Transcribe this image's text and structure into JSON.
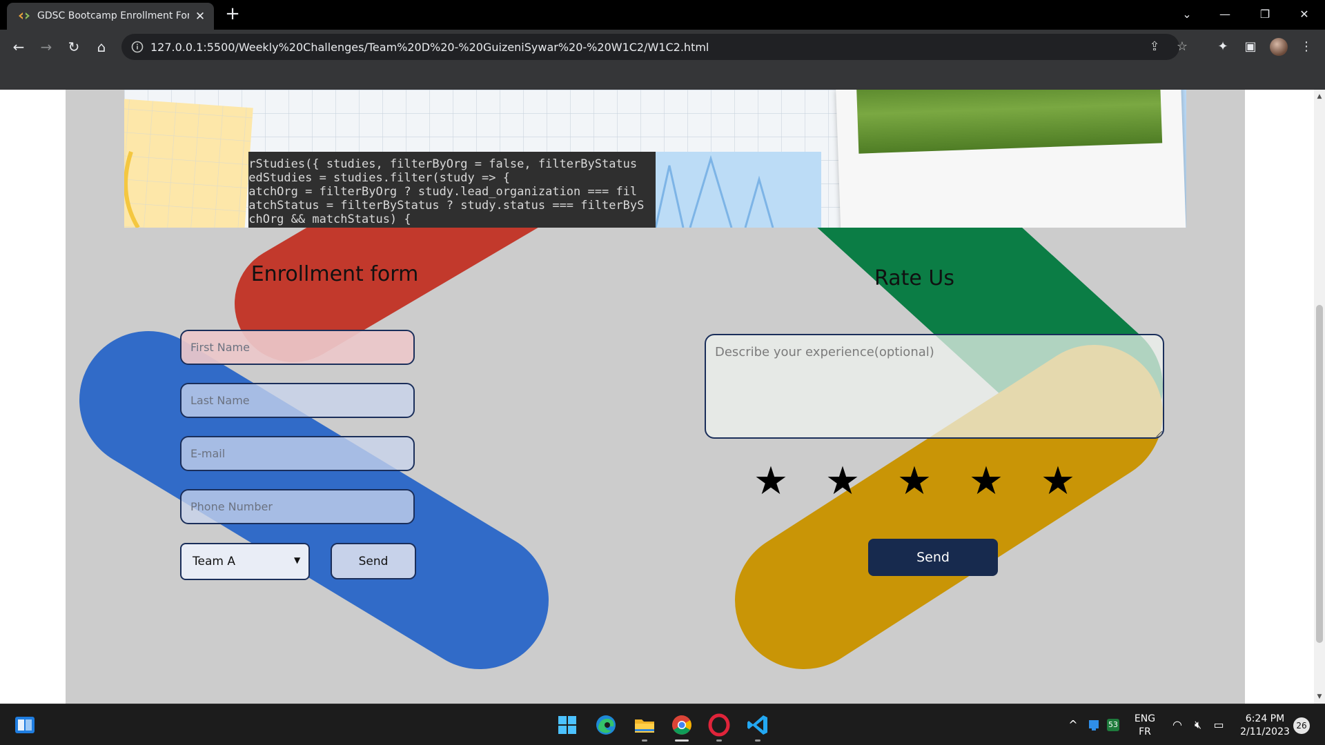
{
  "browser": {
    "tab_title": "GDSC Bootcamp Enrollment Form",
    "new_tab_symbol": "+",
    "url": "127.0.0.1:5500/Weekly%20Challenges/Team%20D%20-%20GuizeniSywar%20-%20W1C2/W1C2.html"
  },
  "banner": {
    "code_lines": [
      "erStudies({ studies, filterByOrg = false, filterByStatus",
      "redStudies = studies.filter(study => {",
      "matchOrg = filterByOrg ? study.lead_organization === fil",
      "matchStatus = filterByStatus ? study.status === filterByS",
      "tchOrg && matchStatus) {"
    ]
  },
  "enrollment": {
    "title": "Enrollment form",
    "first_name_placeholder": "First Name",
    "last_name_placeholder": "Last Name",
    "email_placeholder": "E-mail",
    "phone_placeholder": "Phone Number",
    "team_options": [
      "Team A"
    ],
    "team_selected": "Team A",
    "send_label": "Send"
  },
  "rating": {
    "title": "Rate Us",
    "experience_placeholder": "Describe your experience(optional)",
    "stars": [
      "★",
      "★",
      "★",
      "★",
      "★"
    ],
    "send_label": "Send"
  },
  "taskbar": {
    "language": "ENG",
    "layout": "FR",
    "time": "6:24 PM",
    "date": "2/11/2023",
    "notifications": "26",
    "tray_badge": "53"
  },
  "colors": {
    "red_band": "#c2392c",
    "blue_band": "#316bc8",
    "green_band": "#0b7d45",
    "yellow_band": "#c99506",
    "send_button": "#172a4e"
  }
}
